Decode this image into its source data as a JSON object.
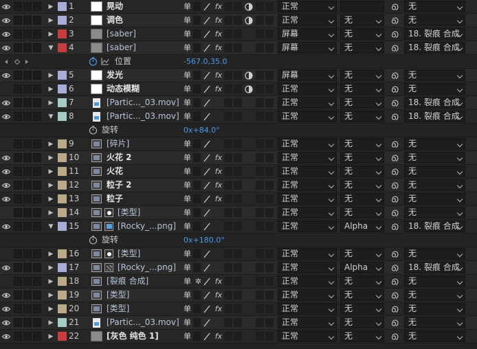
{
  "switch_glyph": "单",
  "fx_label": "fx",
  "layers": [
    {
      "num": "1",
      "name": "晃动",
      "label_color": "#a9acd6",
      "thumb": "solid-w",
      "fx": true,
      "motion_blur": true,
      "mode": "正常",
      "track": "",
      "parent": "无",
      "eye": true
    },
    {
      "num": "2",
      "name": "调色",
      "label_color": "#a9acd6",
      "thumb": "solid-w",
      "fx": true,
      "motion_blur": true,
      "mode": "正常",
      "track": "无",
      "parent": "无",
      "eye": true
    },
    {
      "num": "3",
      "name": "[saber]",
      "label_color": "#c73c3c",
      "thumb": "solid-g",
      "fx": true,
      "motion_blur": false,
      "mode": "屏幕",
      "track": "无",
      "parent": "18. 裂痕 合成",
      "eye": true,
      "bluish": true
    },
    {
      "num": "4",
      "name": "[saber]",
      "label_color": "#c73c3c",
      "thumb": "solid-g",
      "fx": true,
      "motion_blur": false,
      "mode": "屏幕",
      "track": "无",
      "parent": "18. 裂痕 合成",
      "eye": true,
      "expanded": true,
      "bluish": true
    },
    {
      "prop": true,
      "name": "位置",
      "value": "-567.0,35.0",
      "keyframes": true
    },
    {
      "num": "5",
      "name": "发光",
      "label_color": "#a9acd6",
      "thumb": "solid-w",
      "fx": true,
      "motion_blur": true,
      "mode": "屏幕",
      "track": "无",
      "parent": "无",
      "eye": true
    },
    {
      "num": "6",
      "name": "动态模糊",
      "label_color": "#a9acd6",
      "thumb": "solid-w",
      "fx": true,
      "motion_blur": true,
      "mode": "正常",
      "track": "无",
      "parent": "无",
      "eye": false
    },
    {
      "num": "7",
      "name": "[Partic..._03.mov]",
      "label_color": "#a6cbc5",
      "thumb": "file",
      "fx": false,
      "motion_blur": false,
      "mode": "正常",
      "track": "无",
      "parent": "18. 裂痕 合成",
      "eye": true,
      "bluish": true
    },
    {
      "num": "8",
      "name": "[Partic..._03.mov]",
      "label_color": "#a6cbc5",
      "thumb": "file",
      "fx": false,
      "motion_blur": false,
      "mode": "正常",
      "track": "无",
      "parent": "18. 裂痕 合成",
      "eye": true,
      "expanded": true,
      "bluish": true
    },
    {
      "prop": true,
      "name": "旋转",
      "value": "0x+84.0°",
      "keyframes": false
    },
    {
      "num": "9",
      "name": "[碎片]",
      "label_color": "#bca98a",
      "thumb": "comp",
      "fx": false,
      "motion_blur": false,
      "mode": "正常",
      "track": "无",
      "parent": "无",
      "eye": false,
      "bluish": true
    },
    {
      "num": "10",
      "name": "火花 2",
      "label_color": "#bca98a",
      "thumb": "comp",
      "fx": true,
      "motion_blur": false,
      "mode": "正常",
      "track": "无",
      "parent": "无",
      "eye": true
    },
    {
      "num": "11",
      "name": "火花",
      "label_color": "#bca98a",
      "thumb": "comp",
      "fx": true,
      "motion_blur": false,
      "mode": "正常",
      "track": "无",
      "parent": "无",
      "eye": true
    },
    {
      "num": "12",
      "name": "粒子 2",
      "label_color": "#bca98a",
      "thumb": "comp",
      "fx": true,
      "motion_blur": false,
      "mode": "正常",
      "track": "无",
      "parent": "无",
      "eye": true
    },
    {
      "num": "13",
      "name": "粒子",
      "label_color": "#bca98a",
      "thumb": "comp",
      "fx": true,
      "motion_blur": false,
      "mode": "正常",
      "track": "无",
      "parent": "无",
      "eye": true
    },
    {
      "num": "14",
      "name": "[类型]",
      "label_color": "#bca98a",
      "thumb": "comp",
      "thumb2": "dot",
      "fx": false,
      "motion_blur": false,
      "mode": "正常",
      "track": "无",
      "parent": "无",
      "eye": false,
      "bluish": true,
      "indent": true
    },
    {
      "num": "15",
      "name": "[Rocky_...png]",
      "label_color": "#a9acd6",
      "thumb": "comp",
      "thumb2": "img",
      "fx": false,
      "motion_blur": false,
      "mode": "正常",
      "track": "Alpha",
      "parent": "18. 裂痕 合成",
      "eye": true,
      "expanded": true,
      "bluish": true,
      "indent": true
    },
    {
      "prop": true,
      "name": "旋转",
      "value": "0x+180.0°",
      "keyframes": false
    },
    {
      "num": "16",
      "name": "[类型]",
      "label_color": "#bca98a",
      "thumb": "comp",
      "thumb2": "dot",
      "fx": false,
      "motion_blur": false,
      "mode": "正常",
      "track": "无",
      "parent": "无",
      "eye": false,
      "bluish": true,
      "indent": true
    },
    {
      "num": "17",
      "name": "[Rocky_...png]",
      "label_color": "#a9acd6",
      "thumb": "comp",
      "thumb2": "patt",
      "fx": false,
      "motion_blur": false,
      "mode": "正常",
      "track": "Alpha",
      "parent": "18. 裂痕 合成",
      "eye": true,
      "bluish": true,
      "indent": true
    },
    {
      "num": "18",
      "name": "[裂痕 合成]",
      "label_color": "#bca98a",
      "thumb": "comp",
      "fx": true,
      "collapse": true,
      "motion_blur": false,
      "mode": "正常",
      "track": "无",
      "parent": "无",
      "eye": false,
      "bluish": true
    },
    {
      "num": "19",
      "name": "[类型]",
      "label_color": "#bca98a",
      "thumb": "comp",
      "fx": true,
      "motion_blur": false,
      "mode": "正常",
      "track": "无",
      "parent": "无",
      "eye": true,
      "bluish": true
    },
    {
      "num": "20",
      "name": "[类型]",
      "label_color": "#bca98a",
      "thumb": "comp",
      "fx": true,
      "motion_blur": false,
      "mode": "正常",
      "track": "无",
      "parent": "无",
      "eye": true,
      "bluish": true
    },
    {
      "num": "21",
      "name": "[Partic..._03.mov]",
      "label_color": "#a6cbc5",
      "thumb": "file",
      "fx": false,
      "motion_blur": false,
      "mode": "正常",
      "track": "无",
      "parent": "无",
      "eye": true,
      "bluish": true
    },
    {
      "num": "22",
      "name": "[灰色 纯色 1]",
      "label_color": "#c73c3c",
      "thumb": "solid-g",
      "fx": true,
      "motion_blur": false,
      "mode": "正常",
      "track": "无",
      "parent": "无",
      "eye": true
    }
  ]
}
